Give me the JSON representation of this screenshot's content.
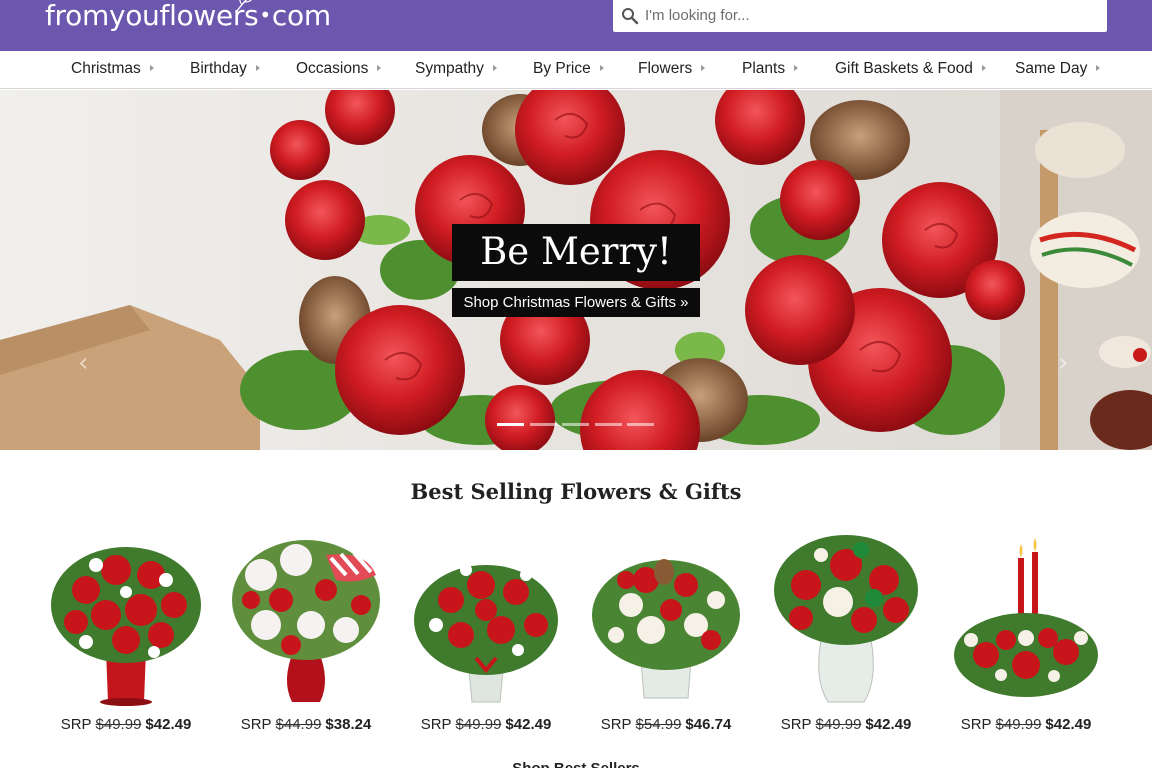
{
  "header": {
    "logo_text_left": "fromyouflowers",
    "logo_dot": "•",
    "logo_text_right": "com",
    "search_placeholder": "I'm looking for..."
  },
  "nav": {
    "items": [
      {
        "label": "Christmas"
      },
      {
        "label": "Birthday"
      },
      {
        "label": "Occasions"
      },
      {
        "label": "Sympathy"
      },
      {
        "label": "By Price"
      },
      {
        "label": "Flowers"
      },
      {
        "label": "Plants"
      },
      {
        "label": "Gift Baskets & Food"
      },
      {
        "label": "Same Day"
      }
    ]
  },
  "hero": {
    "title": "Be Merry!",
    "cta": "Shop Christmas Flowers & Gifts »",
    "prev_arrow": "‹",
    "next_arrow": "›",
    "slide_count": 5,
    "active_slide": 1
  },
  "best_sellers": {
    "title": "Best Selling Flowers & Gifts",
    "products": [
      {
        "srp_label": "SRP",
        "original_price": "$49.99",
        "sale_price": "$42.49"
      },
      {
        "srp_label": "SRP",
        "original_price": "$44.99",
        "sale_price": "$38.24"
      },
      {
        "srp_label": "SRP",
        "original_price": "$49.99",
        "sale_price": "$42.49"
      },
      {
        "srp_label": "SRP",
        "original_price": "$54.99",
        "sale_price": "$46.74"
      },
      {
        "srp_label": "SRP",
        "original_price": "$49.99",
        "sale_price": "$42.49"
      },
      {
        "srp_label": "SRP",
        "original_price": "$49.99",
        "sale_price": "$42.49"
      }
    ],
    "more_link": "Shop Best Sellers"
  },
  "colors": {
    "brand_purple": "#6b57ad",
    "rose_red": "#c8151c",
    "overlay_black": "#0b0b0b"
  }
}
